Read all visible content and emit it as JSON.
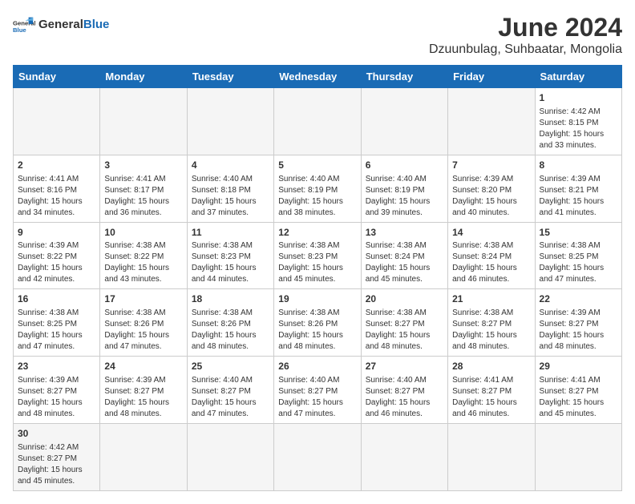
{
  "logo": {
    "text_general": "General",
    "text_blue": "Blue"
  },
  "title": "June 2024",
  "subtitle": "Dzuunbulag, Suhbaatar, Mongolia",
  "days_of_week": [
    "Sunday",
    "Monday",
    "Tuesday",
    "Wednesday",
    "Thursday",
    "Friday",
    "Saturday"
  ],
  "weeks": [
    [
      {
        "day": "",
        "info": "",
        "empty": true
      },
      {
        "day": "",
        "info": "",
        "empty": true
      },
      {
        "day": "",
        "info": "",
        "empty": true
      },
      {
        "day": "",
        "info": "",
        "empty": true
      },
      {
        "day": "",
        "info": "",
        "empty": true
      },
      {
        "day": "",
        "info": "",
        "empty": true
      },
      {
        "day": "1",
        "info": "Sunrise: 4:42 AM\nSunset: 8:15 PM\nDaylight: 15 hours and 33 minutes."
      }
    ],
    [
      {
        "day": "2",
        "info": "Sunrise: 4:41 AM\nSunset: 8:16 PM\nDaylight: 15 hours and 34 minutes."
      },
      {
        "day": "3",
        "info": "Sunrise: 4:41 AM\nSunset: 8:17 PM\nDaylight: 15 hours and 36 minutes."
      },
      {
        "day": "4",
        "info": "Sunrise: 4:40 AM\nSunset: 8:18 PM\nDaylight: 15 hours and 37 minutes."
      },
      {
        "day": "5",
        "info": "Sunrise: 4:40 AM\nSunset: 8:19 PM\nDaylight: 15 hours and 38 minutes."
      },
      {
        "day": "6",
        "info": "Sunrise: 4:40 AM\nSunset: 8:19 PM\nDaylight: 15 hours and 39 minutes."
      },
      {
        "day": "7",
        "info": "Sunrise: 4:39 AM\nSunset: 8:20 PM\nDaylight: 15 hours and 40 minutes."
      },
      {
        "day": "8",
        "info": "Sunrise: 4:39 AM\nSunset: 8:21 PM\nDaylight: 15 hours and 41 minutes."
      }
    ],
    [
      {
        "day": "9",
        "info": "Sunrise: 4:39 AM\nSunset: 8:22 PM\nDaylight: 15 hours and 42 minutes."
      },
      {
        "day": "10",
        "info": "Sunrise: 4:38 AM\nSunset: 8:22 PM\nDaylight: 15 hours and 43 minutes."
      },
      {
        "day": "11",
        "info": "Sunrise: 4:38 AM\nSunset: 8:23 PM\nDaylight: 15 hours and 44 minutes."
      },
      {
        "day": "12",
        "info": "Sunrise: 4:38 AM\nSunset: 8:23 PM\nDaylight: 15 hours and 45 minutes."
      },
      {
        "day": "13",
        "info": "Sunrise: 4:38 AM\nSunset: 8:24 PM\nDaylight: 15 hours and 45 minutes."
      },
      {
        "day": "14",
        "info": "Sunrise: 4:38 AM\nSunset: 8:24 PM\nDaylight: 15 hours and 46 minutes."
      },
      {
        "day": "15",
        "info": "Sunrise: 4:38 AM\nSunset: 8:25 PM\nDaylight: 15 hours and 47 minutes."
      }
    ],
    [
      {
        "day": "16",
        "info": "Sunrise: 4:38 AM\nSunset: 8:25 PM\nDaylight: 15 hours and 47 minutes."
      },
      {
        "day": "17",
        "info": "Sunrise: 4:38 AM\nSunset: 8:26 PM\nDaylight: 15 hours and 47 minutes."
      },
      {
        "day": "18",
        "info": "Sunrise: 4:38 AM\nSunset: 8:26 PM\nDaylight: 15 hours and 48 minutes."
      },
      {
        "day": "19",
        "info": "Sunrise: 4:38 AM\nSunset: 8:26 PM\nDaylight: 15 hours and 48 minutes."
      },
      {
        "day": "20",
        "info": "Sunrise: 4:38 AM\nSunset: 8:27 PM\nDaylight: 15 hours and 48 minutes."
      },
      {
        "day": "21",
        "info": "Sunrise: 4:38 AM\nSunset: 8:27 PM\nDaylight: 15 hours and 48 minutes."
      },
      {
        "day": "22",
        "info": "Sunrise: 4:39 AM\nSunset: 8:27 PM\nDaylight: 15 hours and 48 minutes."
      }
    ],
    [
      {
        "day": "23",
        "info": "Sunrise: 4:39 AM\nSunset: 8:27 PM\nDaylight: 15 hours and 48 minutes."
      },
      {
        "day": "24",
        "info": "Sunrise: 4:39 AM\nSunset: 8:27 PM\nDaylight: 15 hours and 48 minutes."
      },
      {
        "day": "25",
        "info": "Sunrise: 4:40 AM\nSunset: 8:27 PM\nDaylight: 15 hours and 47 minutes."
      },
      {
        "day": "26",
        "info": "Sunrise: 4:40 AM\nSunset: 8:27 PM\nDaylight: 15 hours and 47 minutes."
      },
      {
        "day": "27",
        "info": "Sunrise: 4:40 AM\nSunset: 8:27 PM\nDaylight: 15 hours and 46 minutes."
      },
      {
        "day": "28",
        "info": "Sunrise: 4:41 AM\nSunset: 8:27 PM\nDaylight: 15 hours and 46 minutes."
      },
      {
        "day": "29",
        "info": "Sunrise: 4:41 AM\nSunset: 8:27 PM\nDaylight: 15 hours and 45 minutes."
      }
    ],
    [
      {
        "day": "30",
        "info": "Sunrise: 4:42 AM\nSunset: 8:27 PM\nDaylight: 15 hours and 45 minutes.",
        "last": true
      },
      {
        "day": "",
        "info": "",
        "empty": true,
        "last": true
      },
      {
        "day": "",
        "info": "",
        "empty": true,
        "last": true
      },
      {
        "day": "",
        "info": "",
        "empty": true,
        "last": true
      },
      {
        "day": "",
        "info": "",
        "empty": true,
        "last": true
      },
      {
        "day": "",
        "info": "",
        "empty": true,
        "last": true
      },
      {
        "day": "",
        "info": "",
        "empty": true,
        "last": true
      }
    ]
  ]
}
